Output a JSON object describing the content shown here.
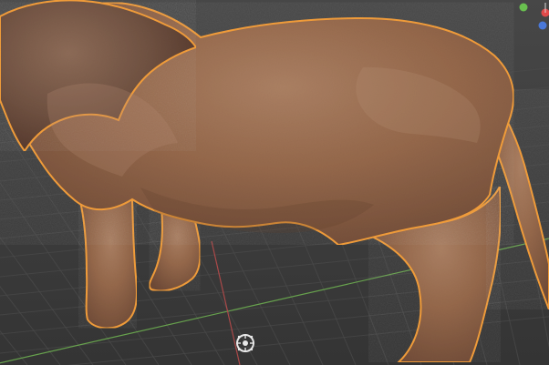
{
  "viewport": {
    "title": "",
    "mode": "",
    "selected_outline_color": "#f29d3a",
    "background_color": "#3d3d3d",
    "grid_color": "#4b4b4b",
    "x_axis_color": "#b74b4b",
    "y_axis_color": "#6aa84f",
    "origin_marker_color": "#e7e7e7"
  },
  "overlay": {
    "gizmo": {
      "y_color": "#69c04f",
      "x_color": "#e04a4a",
      "z_color": "#4a78d8"
    }
  },
  "model": {
    "name": "",
    "fur_color": "#9a6a49",
    "fur_shadow": "#6f4a34",
    "mane_color": "#7a5a45"
  }
}
